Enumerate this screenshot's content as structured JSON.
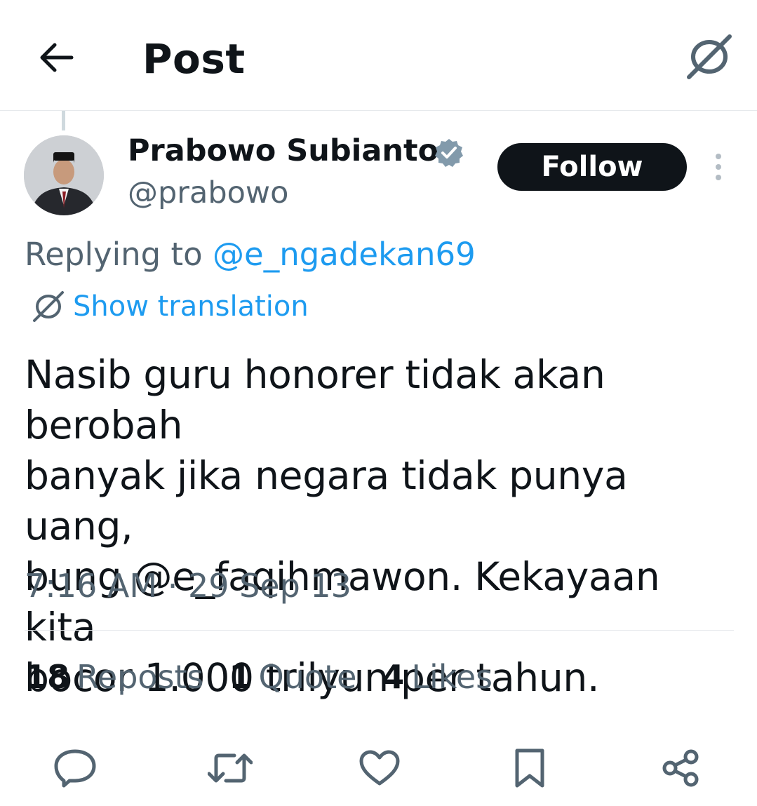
{
  "header": {
    "title": "Post",
    "back_icon": "arrow-left-icon",
    "translate_icon": "translate-icon"
  },
  "author": {
    "name": "Prabowo Subianto",
    "handle": "@prabowo",
    "verified": true,
    "verified_color": "#829aab",
    "follow_label": "Follow"
  },
  "reply": {
    "prefix": "Replying to",
    "to": "@e_ngadekan69"
  },
  "translation": {
    "label": "Show translation"
  },
  "post": {
    "text": "Nasib guru honorer tidak akan berobah\nbanyak jika negara tidak punya uang,\nbung @e_faqihmawon. Kekayaan kita\nbocor 1.000 trilyun per tahun.",
    "timestamp": "7:16 AM · 29 Sep 13"
  },
  "stats": [
    {
      "count": "18",
      "label": "Reposts"
    },
    {
      "count": "1",
      "label": "Quote"
    },
    {
      "count": "4",
      "label": "Likes"
    }
  ],
  "actions": [
    "reply-icon",
    "repost-icon",
    "like-icon",
    "bookmark-icon",
    "share-icon"
  ],
  "colors": {
    "accent": "#1d9bf0",
    "text": "#0f1419",
    "secondary": "#536471",
    "button_bg": "#0f1419"
  }
}
